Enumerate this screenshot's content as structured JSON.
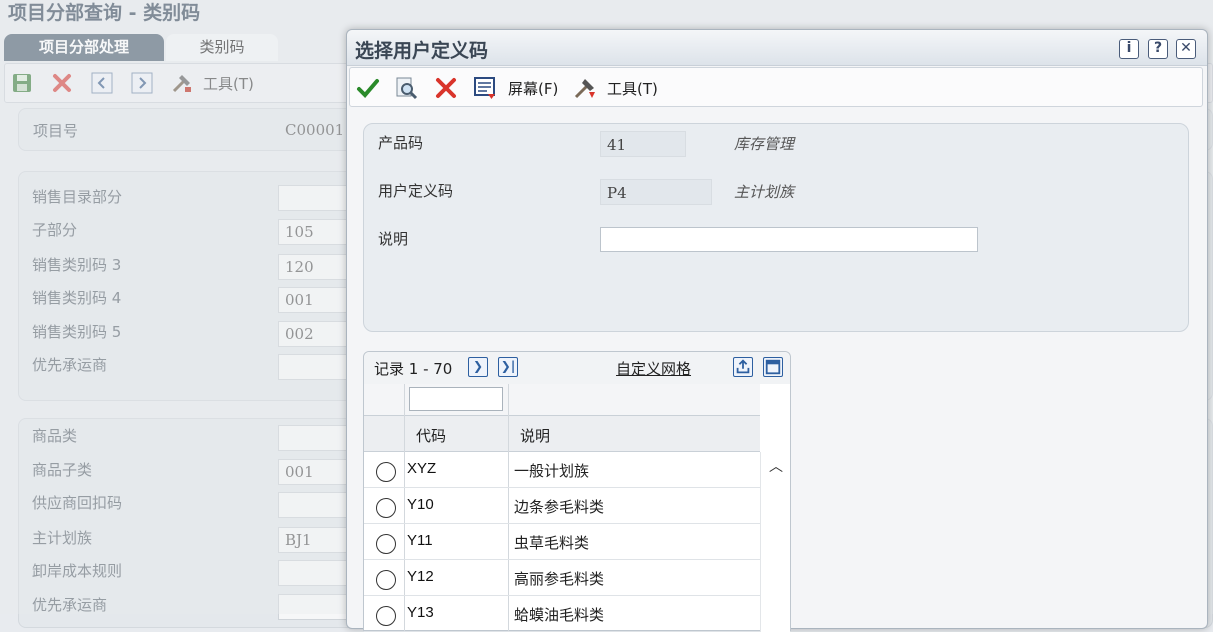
{
  "page_title": "项目分部查询 - 类别码",
  "bg_tabs": {
    "active": "项目分部处理",
    "inactive": "类别码"
  },
  "bg_toolbar": {
    "tools_label": "工具(T)"
  },
  "bg_fields": {
    "item_no_label": "项目号",
    "item_no_value": "C00001",
    "sales_catalog_label": "销售目录部分",
    "sales_catalog_value": "",
    "sub_section_label": "子部分",
    "sub_section_value": "105",
    "sales_cat3_label": "销售类别码 3",
    "sales_cat3_value": "120",
    "sales_cat4_label": "销售类别码 4",
    "sales_cat4_value": "001",
    "sales_cat5_label": "销售类别码 5",
    "sales_cat5_value": "002",
    "carrier_label": "优先承运商",
    "carrier_value": "",
    "commodity_label": "商品类",
    "commodity_value": "",
    "commodity_sub_label": "商品子类",
    "commodity_sub_value": "001",
    "rebate_label": "供应商回扣码",
    "rebate_value": "",
    "master_plan_label": "主计划族",
    "master_plan_value": "BJ1",
    "landed_cost_label": "卸岸成本规则",
    "landed_cost_value": "",
    "carrier2_label": "优先承运商",
    "carrier2_value": ""
  },
  "modal": {
    "title": "选择用户定义码",
    "toolbar": {
      "screen_label": "屏幕(F)",
      "tools_label": "工具(T)"
    },
    "form": {
      "product_code_label": "产品码",
      "product_code_value": "41",
      "product_code_desc": "库存管理",
      "udc_label": "用户定义码",
      "udc_value": "P4",
      "udc_desc": "主计划族",
      "description_label": "说明",
      "description_value": ""
    },
    "grid": {
      "records": "记录 1 - 70",
      "customize": "自定义网格",
      "columns": [
        "代码",
        "说明"
      ],
      "rows": [
        {
          "code": "XYZ",
          "desc": "一般计划族"
        },
        {
          "code": "Y10",
          "desc": "边条参毛料类"
        },
        {
          "code": "Y11",
          "desc": "虫草毛料类"
        },
        {
          "code": "Y12",
          "desc": "高丽参毛料类"
        },
        {
          "code": "Y13",
          "desc": "蛤蟆油毛料类"
        }
      ]
    }
  }
}
